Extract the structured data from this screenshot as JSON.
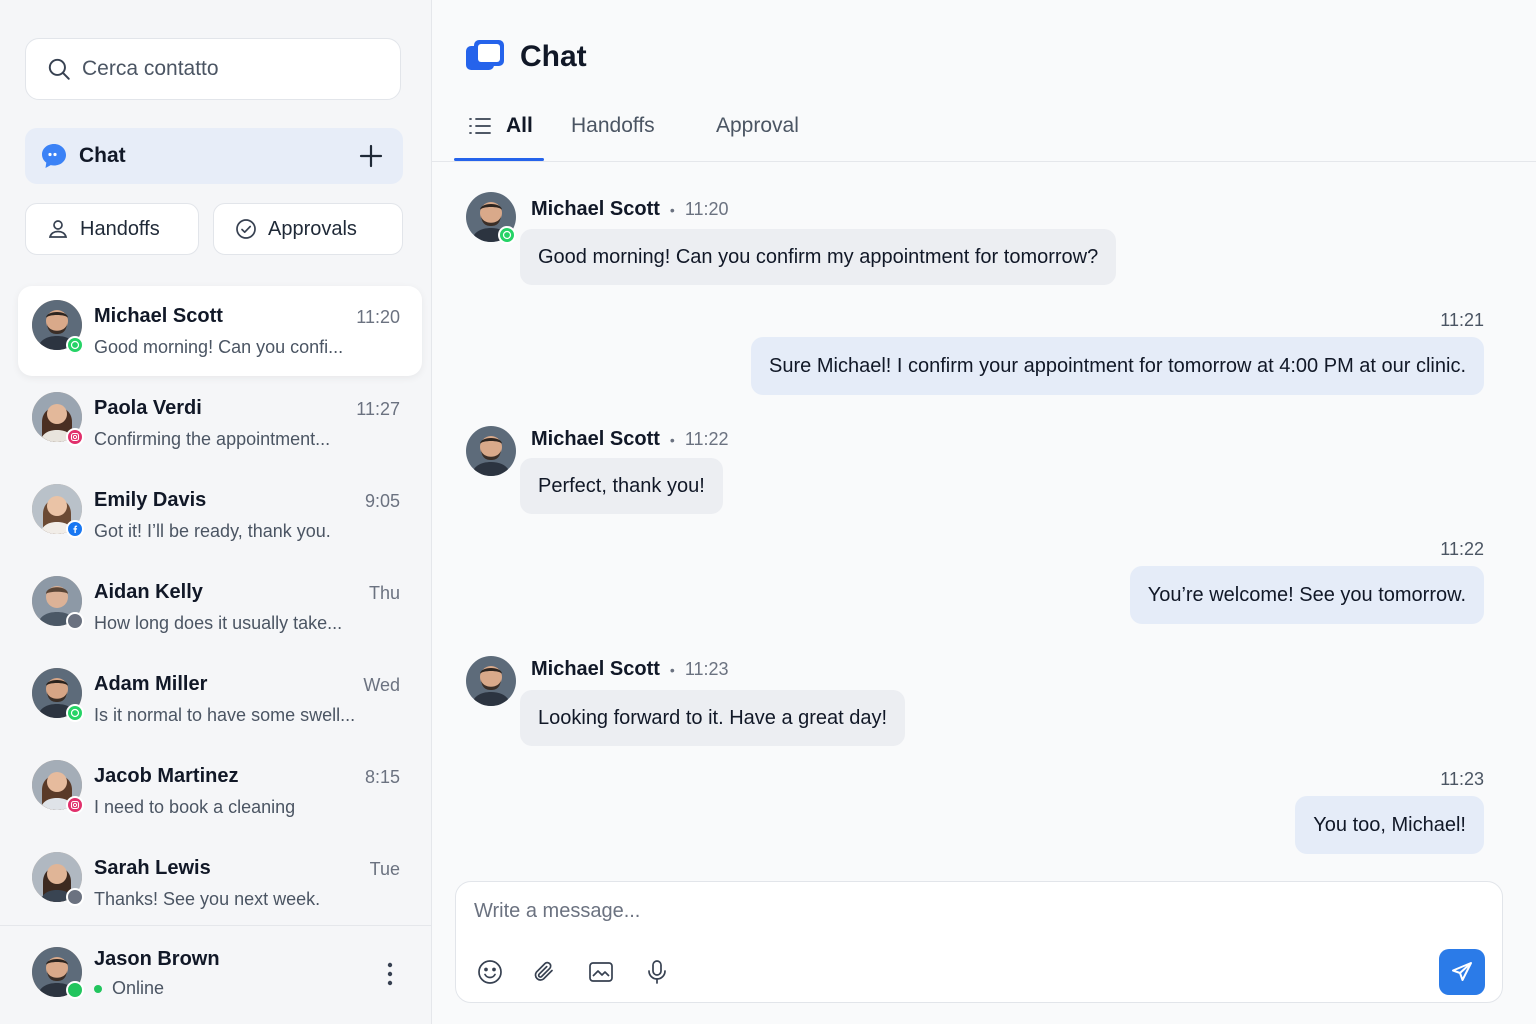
{
  "sidebar": {
    "search": {
      "placeholder": "Cerca contatto"
    },
    "chat_button": {
      "label": "Chat"
    },
    "filters": {
      "handoffs": "Handoffs",
      "approvals": "Approvals"
    },
    "contacts": [
      {
        "name": "Michael Scott",
        "time": "11:20",
        "preview": "Good morning! Can you confi...",
        "channel": "whatsapp",
        "active": true
      },
      {
        "name": "Paola Verdi",
        "time": "11:27",
        "preview": "Confirming the appointment...",
        "channel": "instagram"
      },
      {
        "name": "Emily Davis",
        "time": "9:05",
        "preview": "Got it! I’ll be ready, thank you.",
        "channel": "facebook"
      },
      {
        "name": "Aidan Kelly",
        "time": "Thu",
        "preview": "How long does it usually take...",
        "channel": "offline"
      },
      {
        "name": "Adam Miller",
        "time": "Wed",
        "preview": "Is it normal to have some swell...",
        "channel": "whatsapp"
      },
      {
        "name": "Jacob Martinez",
        "time": "8:15",
        "preview": "I need to book a cleaning",
        "channel": "instagram"
      },
      {
        "name": "Sarah Lewis",
        "time": "Tue",
        "preview": "Thanks! See you next week.",
        "channel": "offline"
      }
    ],
    "current_user": {
      "name": "Jason Brown",
      "status": "Online"
    }
  },
  "main": {
    "title": "Chat",
    "tabs": [
      {
        "label": "All",
        "active": true
      },
      {
        "label": "Handoffs"
      },
      {
        "label": "Approval"
      }
    ],
    "messages": [
      {
        "direction": "in",
        "sender": "Michael Scott",
        "time": "11:20",
        "text": "Good morning! Can you confirm my appointment for tomorrow?"
      },
      {
        "direction": "out",
        "time": "11:21",
        "text": "Sure Michael! I confirm your appointment for tomorrow at 4:00 PM at our clinic."
      },
      {
        "direction": "in",
        "sender": "Michael Scott",
        "time": "11:22",
        "text": "Perfect, thank you!"
      },
      {
        "direction": "out",
        "time": "11:22",
        "text": "You’re welcome! See you tomorrow."
      },
      {
        "direction": "in",
        "sender": "Michael Scott",
        "time": "11:23",
        "text": "Looking forward to it. Have a great day!"
      },
      {
        "direction": "out",
        "time": "11:23",
        "text": "You too, Michael!"
      }
    ],
    "composer": {
      "placeholder": "Write a message..."
    },
    "separator": "•"
  },
  "colors": {
    "accent": "#2563eb",
    "send_button": "#2b7be8",
    "whatsapp": "#25d366",
    "instagram": "#e1306c",
    "facebook": "#1877f2",
    "online": "#22c55e",
    "offline": "#6b7280"
  },
  "icons": {
    "search": "search-icon",
    "chat": "chat-bubble-icon",
    "add": "plus-icon",
    "handoffs": "user-icon",
    "approvals": "check-circle-icon",
    "tab_all": "list-icon",
    "more": "kebab-icon",
    "composer": [
      "emoji-icon",
      "paperclip-icon",
      "image-icon",
      "microphone-icon"
    ],
    "send": "send-icon"
  }
}
